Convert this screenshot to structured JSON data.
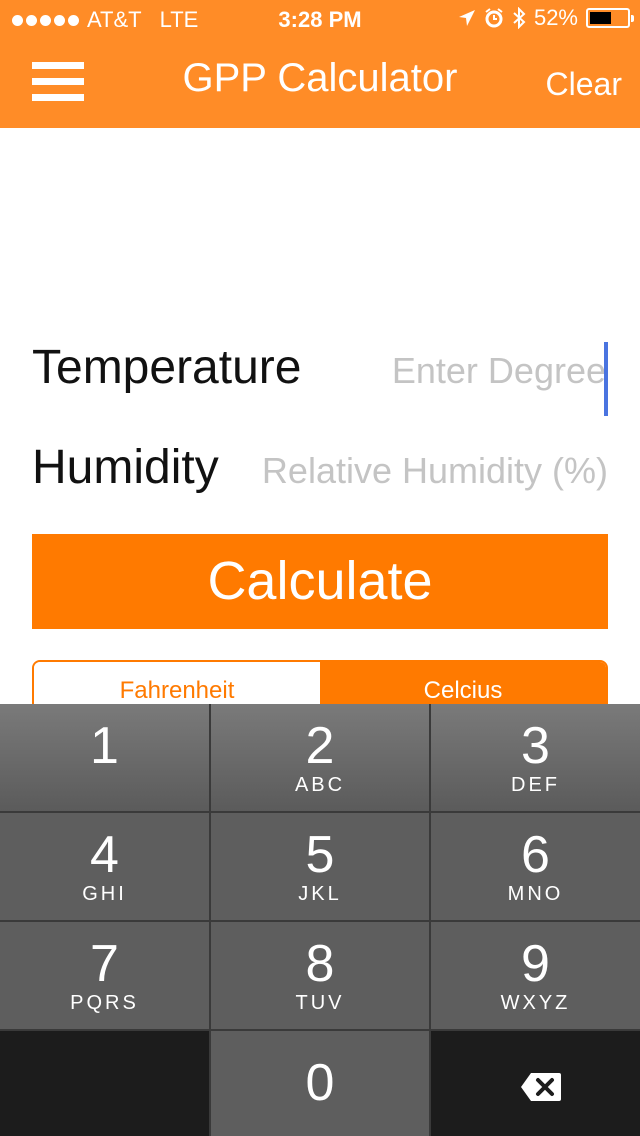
{
  "status_bar": {
    "carrier": "AT&T",
    "network": "LTE",
    "time": "3:28 PM",
    "battery": "52%"
  },
  "nav": {
    "title": "GPP Calculator",
    "clear_label": "Clear"
  },
  "form": {
    "temperature_label": "Temperature",
    "temperature_placeholder": "Enter Degree",
    "humidity_label": "Humidity",
    "humidity_placeholder": "Relative Humidity (%)",
    "calculate_label": "Calculate",
    "unit_options": [
      "Fahrenheit",
      "Celcius"
    ],
    "selected_unit": "Celcius"
  },
  "keypad": {
    "keys": [
      {
        "num": "1",
        "letters": ""
      },
      {
        "num": "2",
        "letters": "ABC"
      },
      {
        "num": "3",
        "letters": "DEF"
      },
      {
        "num": "4",
        "letters": "GHI"
      },
      {
        "num": "5",
        "letters": "JKL"
      },
      {
        "num": "6",
        "letters": "MNO"
      },
      {
        "num": "7",
        "letters": "PQRS"
      },
      {
        "num": "8",
        "letters": "TUV"
      },
      {
        "num": "9",
        "letters": "WXYZ"
      },
      {
        "num": "0",
        "letters": ""
      }
    ]
  },
  "colors": {
    "accent": "#FF7A00",
    "nav_bar": "#FF8C27",
    "cursor": "#4A74E0"
  }
}
